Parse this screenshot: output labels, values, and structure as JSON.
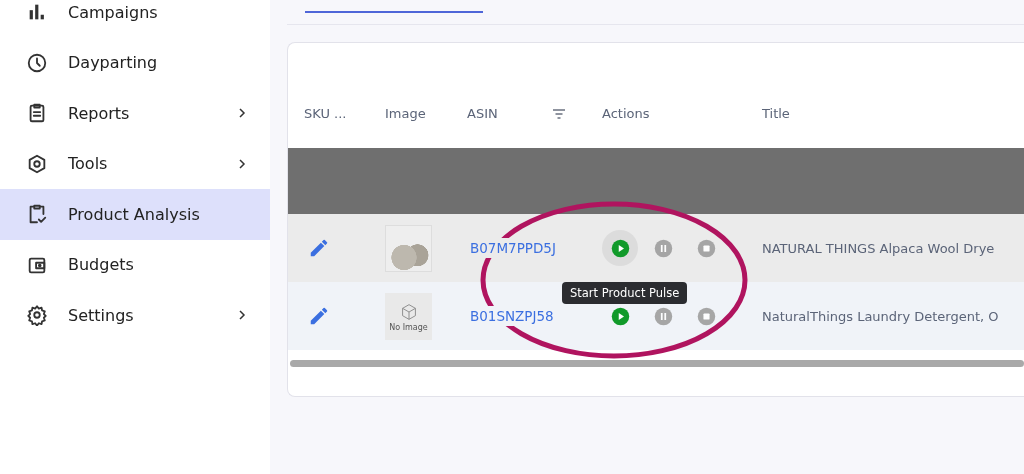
{
  "sidebar": {
    "items": [
      {
        "label": "Campaigns",
        "selected": false,
        "has_submenu": false
      },
      {
        "label": "Dayparting",
        "selected": false,
        "has_submenu": false
      },
      {
        "label": "Reports",
        "selected": false,
        "has_submenu": true
      },
      {
        "label": "Tools",
        "selected": false,
        "has_submenu": true
      },
      {
        "label": "Product Analysis",
        "selected": true,
        "has_submenu": false
      },
      {
        "label": "Budgets",
        "selected": false,
        "has_submenu": false
      },
      {
        "label": "Settings",
        "selected": false,
        "has_submenu": true
      }
    ]
  },
  "table": {
    "columns": [
      {
        "label": "SKU ...",
        "filter": false
      },
      {
        "label": "Image",
        "filter": false
      },
      {
        "label": "ASIN",
        "filter": true
      },
      {
        "label": "Actions",
        "filter": false
      },
      {
        "label": "Title",
        "filter": false
      }
    ],
    "rows": [
      {
        "highlighted": true,
        "image": {
          "kind": "photo"
        },
        "asin": "B07M7PPD5J",
        "play_hovered": true,
        "tooltip": "Start Product Pulse",
        "pause_disabled": true,
        "stop_disabled": true,
        "title": "NATURAL THINGS Alpaca Wool Drye"
      },
      {
        "highlighted": false,
        "image": {
          "kind": "placeholder",
          "text": "No Image"
        },
        "asin": "B01SNZPJ58",
        "play_hovered": false,
        "pause_disabled": true,
        "stop_disabled": true,
        "title": "NaturalThings Laundry Detergent, O"
      }
    ]
  }
}
